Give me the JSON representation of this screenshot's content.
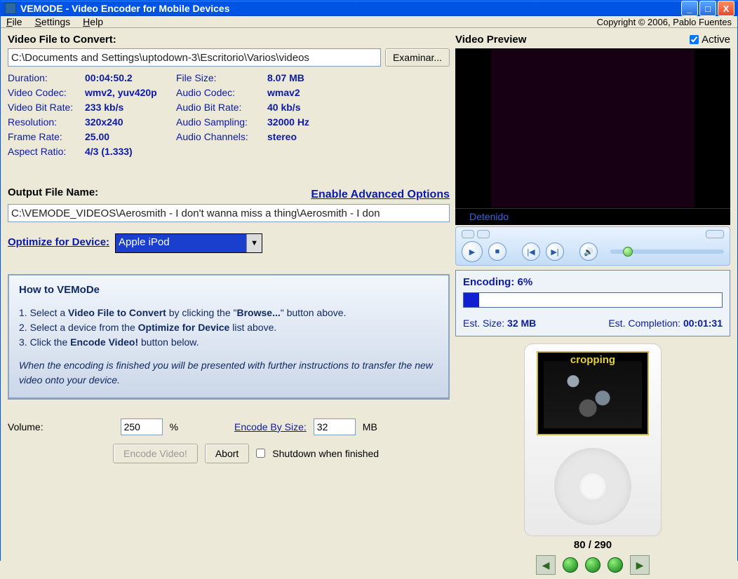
{
  "window": {
    "title": "VEMODE - Video Encoder for Mobile Devices",
    "min": "_",
    "max": "□",
    "close": "X"
  },
  "menu": {
    "file": "File",
    "settings": "Settings",
    "help": "Help",
    "copyright": "Copyright © 2006, Pablo Fuentes"
  },
  "input": {
    "label": "Video File to Convert:",
    "path": "C:\\Documents and Settings\\uptodown-3\\Escritorio\\Varios\\videos",
    "browse": "Examinar..."
  },
  "props": {
    "duration_l": "Duration:",
    "duration_v": "00:04:50.2",
    "filesize_l": "File Size:",
    "filesize_v": "8.07 MB",
    "vcodec_l": "Video Codec:",
    "vcodec_v": "wmv2, yuv420p",
    "acodec_l": "Audio Codec:",
    "acodec_v": "wmav2",
    "vbitrate_l": "Video Bit Rate:",
    "vbitrate_v": "233 kb/s",
    "abitrate_l": "Audio Bit Rate:",
    "abitrate_v": "40 kb/s",
    "res_l": "Resolution:",
    "res_v": "320x240",
    "asamp_l": "Audio Sampling:",
    "asamp_v": "32000 Hz",
    "fps_l": "Frame Rate:",
    "fps_v": "25.00",
    "achan_l": "Audio Channels:",
    "achan_v": "stereo",
    "aspect_l": "Aspect Ratio:",
    "aspect_v": "4/3 (1.333)"
  },
  "output": {
    "label": "Output File Name:",
    "adv_link": "Enable Advanced Options",
    "path": "C:\\VEMODE_VIDEOS\\Aerosmith - I don't wanna miss a thing\\Aerosmith - I don"
  },
  "device": {
    "label": "Optimize for Device:",
    "selected": "Apple iPod"
  },
  "howto": {
    "title": "How to VEMoDe",
    "l1a": "1. Select a ",
    "l1b": "Video File to Convert",
    "l1c": " by clicking the \"",
    "l1d": "Browse...",
    "l1e": "\" button above.",
    "l2a": "2. Select a device from the ",
    "l2b": "Optimize for Device",
    "l2c": " list above.",
    "l3a": "3. Click the ",
    "l3b": "Encode Video!",
    "l3c": " button below.",
    "footer": "When the encoding is finished you will be presented with further instructions to transfer the new video onto your device."
  },
  "volume": {
    "label": "Volume:",
    "value": "250",
    "unit": "%"
  },
  "encsize": {
    "label": "Encode By Size:",
    "value": "32",
    "unit": "MB"
  },
  "actions": {
    "encode": "Encode Video!",
    "abort": "Abort",
    "shutdown": "Shutdown when finished"
  },
  "preview": {
    "label": "Video Preview",
    "active": "Active",
    "status": "Detenido"
  },
  "player": {
    "play": "▶",
    "stop": "■",
    "rew": "|◀",
    "fwd": "▶|",
    "speaker": "🔊"
  },
  "encoding": {
    "label": "Encoding: ",
    "pct": "6%",
    "est_size_l": "Est. Size: ",
    "est_size_v": "32 MB",
    "est_comp_l": "Est. Completion: ",
    "est_comp_v": "00:01:31"
  },
  "ipod": {
    "crop": "cropping"
  },
  "frames": {
    "counter": "80 / 290",
    "left": "◀",
    "right": "▶"
  }
}
